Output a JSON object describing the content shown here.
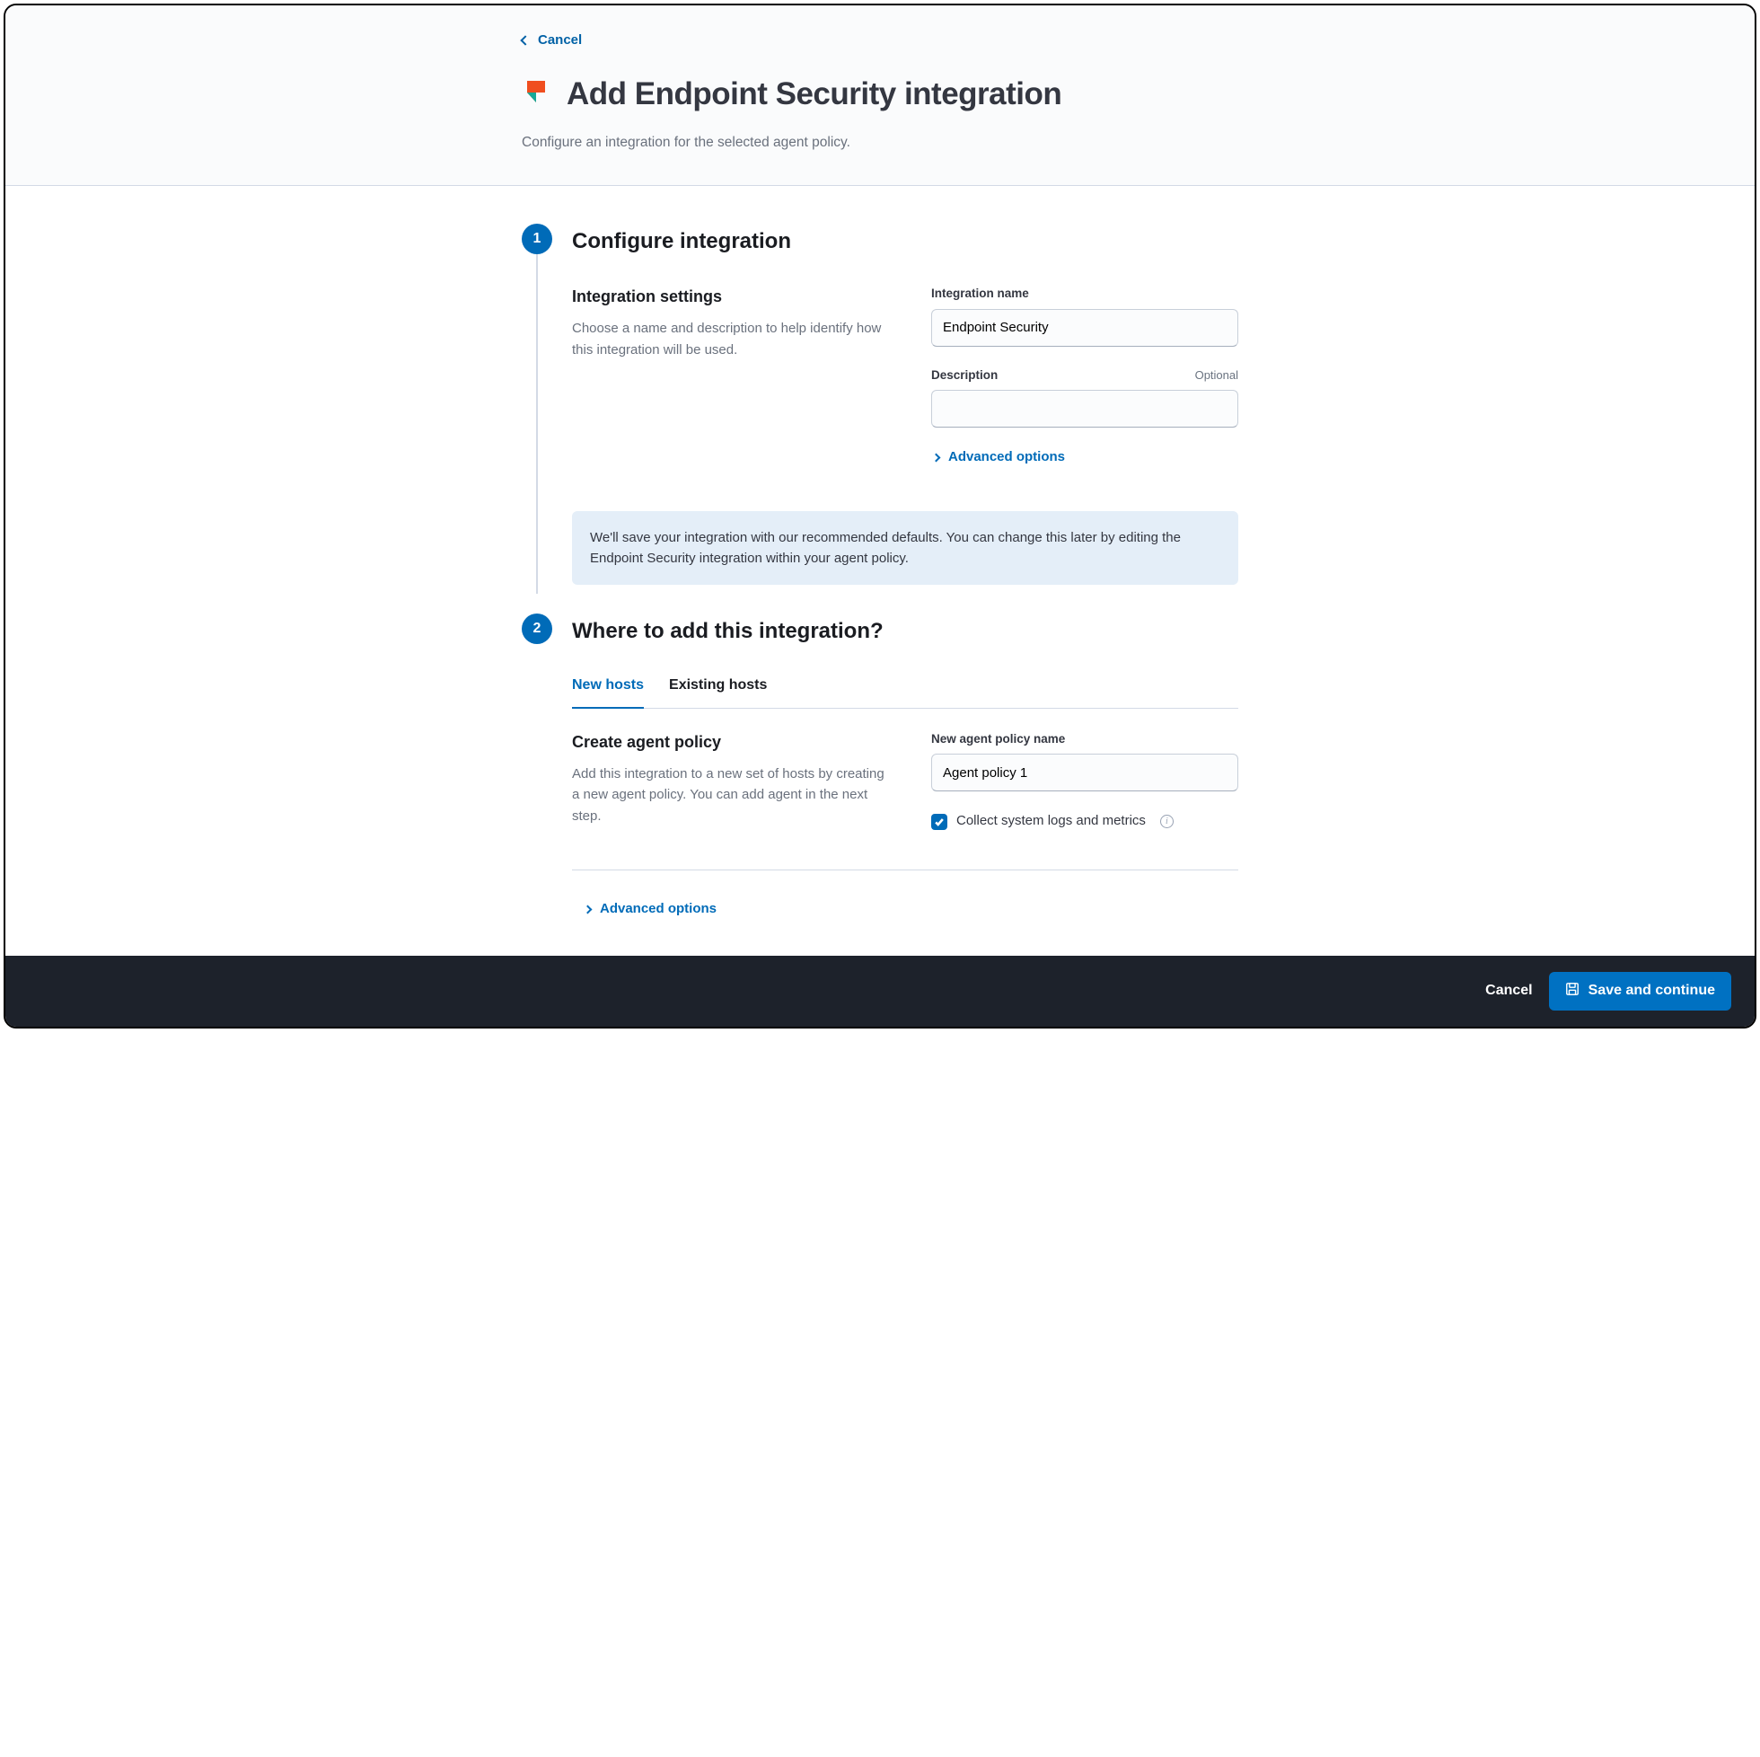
{
  "header": {
    "back_label": "Cancel",
    "title": "Add Endpoint Security integration",
    "subtitle": "Configure an integration for the selected agent policy."
  },
  "step1": {
    "number": "1",
    "title": "Configure integration",
    "section_heading": "Integration settings",
    "section_desc": "Choose a name and description to help identify how this integration will be used.",
    "name_label": "Integration name",
    "name_value": "Endpoint Security",
    "desc_label": "Description",
    "desc_optional": "Optional",
    "desc_value": "",
    "advanced_label": "Advanced options",
    "callout": "We'll save your integration with our recommended defaults. You can change this later by editing the Endpoint Security integration within your agent policy."
  },
  "step2": {
    "number": "2",
    "title": "Where to add this integration?",
    "tabs": [
      {
        "label": "New hosts",
        "active": true
      },
      {
        "label": "Existing hosts",
        "active": false
      }
    ],
    "section_heading": "Create agent policy",
    "section_desc": "Add this integration to a new set of hosts by creating a new agent policy. You can add agent in the next step.",
    "policy_label": "New agent policy name",
    "policy_value": "Agent policy 1",
    "checkbox_label": "Collect system logs and metrics",
    "checkbox_checked": true,
    "advanced_label": "Advanced options"
  },
  "footer": {
    "cancel": "Cancel",
    "save": "Save and continue"
  }
}
